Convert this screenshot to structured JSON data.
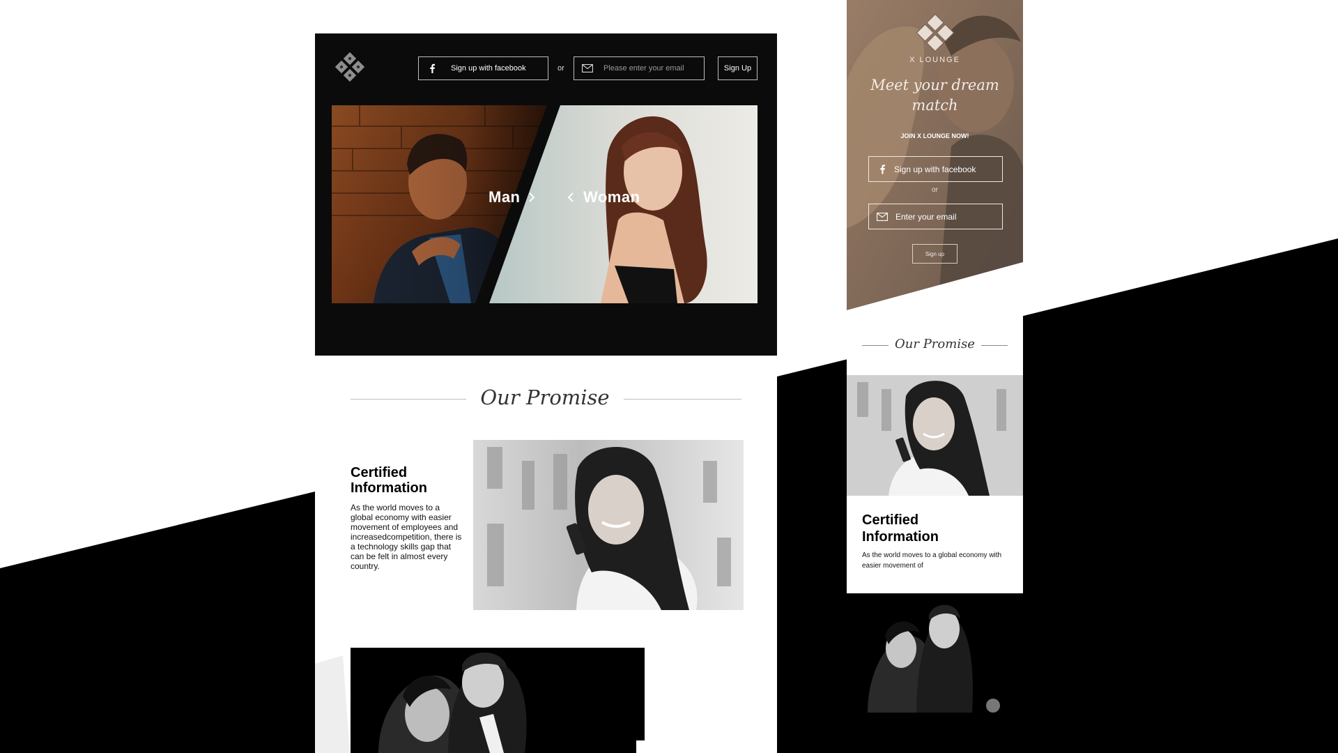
{
  "desktop": {
    "header": {
      "facebook_button": "Sign up with facebook",
      "or": "or",
      "email_placeholder": "Please enter your email",
      "signup_button": "Sign Up"
    },
    "hero": {
      "man_label": "Man",
      "woman_label": "Woman"
    },
    "promise": {
      "title": "Our Promise",
      "card_title_line1": "Certified",
      "card_title_line2": "Information",
      "card_body": "As the world moves to a global economy with easier movement of employees and increasedcompetition, there is a technology skills gap that can be felt in almost every country."
    }
  },
  "mobile": {
    "brand": "X LOUNGE",
    "headline_line1": "Meet your dream",
    "headline_line2": "match",
    "join_text": "JOIN X LOUNGE NOW!",
    "facebook_button": "Sign up with facebook",
    "or": "or",
    "email_placeholder": "Enter your email",
    "signup_button": "Sign up",
    "promise_title": "Our Promise",
    "card_title_line1": "Certified",
    "card_title_line2": "Information",
    "card_body": "As the world moves to a global economy with easier movement of"
  },
  "colors": {
    "hero_bg": "#0b0b0b",
    "accent_black": "#000000",
    "mobile_overlay": "#7a6556"
  },
  "icons": [
    "diamond-logo-icon",
    "facebook-icon",
    "envelope-icon",
    "chevron-right-icon",
    "chevron-left-icon"
  ]
}
